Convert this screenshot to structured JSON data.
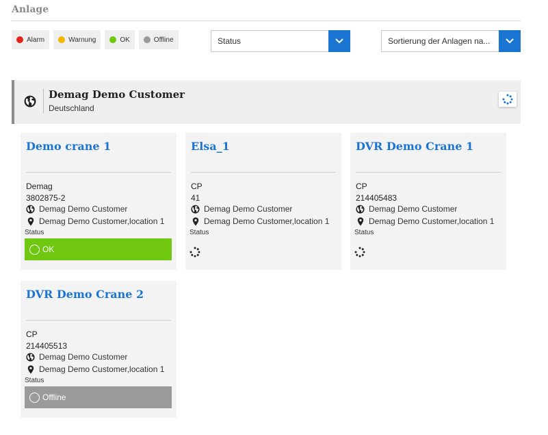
{
  "page": {
    "title": "Anlage"
  },
  "legend": [
    {
      "label": "Alarm",
      "color": "#e2231a"
    },
    {
      "label": "Warnung",
      "color": "#f5b800"
    },
    {
      "label": "OK",
      "color": "#6fc80f"
    },
    {
      "label": "Offline",
      "color": "#9a9a9a"
    }
  ],
  "filters": {
    "status_value": "Status",
    "sort_value": "Sortierung der Anlagen na..."
  },
  "customer": {
    "name": "Demag Demo Customer",
    "country": "Deutschland"
  },
  "cards": [
    {
      "title": "Demo crane 1",
      "manufacturer": "Demag",
      "serial": "3802875-2",
      "customer": "Demag Demo Customer",
      "location": "Demag Demo Customer,location 1",
      "status_label": "Status",
      "status_text": "OK"
    },
    {
      "title": "Elsa_1",
      "manufacturer": "CP",
      "serial": "41",
      "customer": "Demag Demo Customer",
      "location": "Demag Demo Customer,location 1",
      "status_label": "Status",
      "status_text": ""
    },
    {
      "title": "DVR Demo Crane 1",
      "manufacturer": "CP",
      "serial": "214405483",
      "customer": "Demag Demo Customer",
      "location": "Demag Demo Customer,location 1",
      "status_label": "Status",
      "status_text": ""
    },
    {
      "title": "DVR Demo Crane 2",
      "manufacturer": "CP",
      "serial": "214405513",
      "customer": "Demag Demo Customer",
      "location": "Demag Demo Customer,location 1",
      "status_label": "Status",
      "status_text": "Offline"
    }
  ],
  "colors": {
    "accent": "#1a75d2",
    "ok": "#6fc80f",
    "offline": "#9a9a9a"
  },
  "icons": {
    "globe": "globe-icon",
    "location": "map-pin-icon",
    "chevron": "chevron-down-icon",
    "loading": "loading-spinner-icon"
  }
}
